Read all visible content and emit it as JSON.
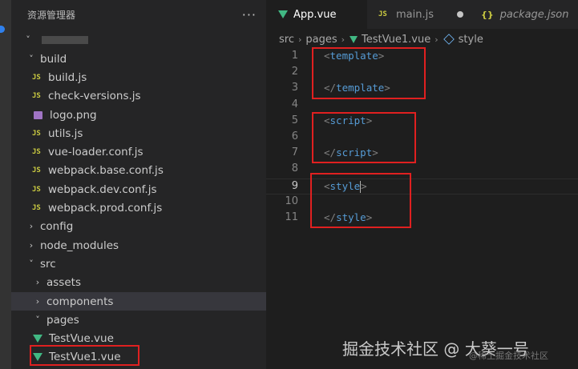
{
  "sidebar": {
    "title": "资源管理器",
    "more": "···",
    "tree": [
      {
        "label": "",
        "kind": "root-redacted",
        "depth": 0,
        "chev": "˅"
      },
      {
        "label": "build",
        "kind": "folder",
        "depth": 1,
        "chev": "˅"
      },
      {
        "label": "build.js",
        "kind": "js",
        "depth": 2
      },
      {
        "label": "check-versions.js",
        "kind": "js",
        "depth": 2
      },
      {
        "label": "logo.png",
        "kind": "img",
        "depth": 2
      },
      {
        "label": "utils.js",
        "kind": "js",
        "depth": 2
      },
      {
        "label": "vue-loader.conf.js",
        "kind": "js",
        "depth": 2
      },
      {
        "label": "webpack.base.conf.js",
        "kind": "js",
        "depth": 2
      },
      {
        "label": "webpack.dev.conf.js",
        "kind": "js",
        "depth": 2
      },
      {
        "label": "webpack.prod.conf.js",
        "kind": "js",
        "depth": 2
      },
      {
        "label": "config",
        "kind": "folder",
        "depth": 1,
        "chev": "›"
      },
      {
        "label": "node_modules",
        "kind": "folder",
        "depth": 1,
        "chev": "›"
      },
      {
        "label": "src",
        "kind": "folder",
        "depth": 1,
        "chev": "˅"
      },
      {
        "label": "assets",
        "kind": "folder",
        "depth": 2,
        "chev": "›"
      },
      {
        "label": "components",
        "kind": "folder",
        "depth": 2,
        "chev": "›",
        "selected": true
      },
      {
        "label": "pages",
        "kind": "folder",
        "depth": 2,
        "chev": "˅"
      },
      {
        "label": "TestVue.vue",
        "kind": "vue",
        "depth": 3
      },
      {
        "label": "TestVue1.vue",
        "kind": "vue",
        "depth": 3
      }
    ]
  },
  "tabs": [
    {
      "label": "App.vue",
      "kind": "vue",
      "active": true
    },
    {
      "label": "main.js",
      "kind": "js",
      "dirty": true
    },
    {
      "label": "package.json",
      "kind": "json",
      "italic": true
    }
  ],
  "icons": {
    "js": "JS",
    "json": "{}",
    "chev_right": "›",
    "chev_down": "˅"
  },
  "breadcrumb": {
    "parts": [
      "src",
      "pages",
      "TestVue1.vue",
      "style"
    ],
    "sep": "›"
  },
  "editor": {
    "current_line": 9,
    "lines": [
      {
        "n": "1",
        "tag": "template",
        "close": false
      },
      {
        "n": "2"
      },
      {
        "n": "3",
        "tag": "template",
        "close": true
      },
      {
        "n": "4"
      },
      {
        "n": "5",
        "tag": "script",
        "close": false
      },
      {
        "n": "6"
      },
      {
        "n": "7",
        "tag": "script",
        "close": true
      },
      {
        "n": "8"
      },
      {
        "n": "9",
        "tag": "style",
        "close": false,
        "cursor": true
      },
      {
        "n": "10"
      },
      {
        "n": "11",
        "tag": "style",
        "close": true
      }
    ]
  },
  "watermark": {
    "main": "掘金技术社区 @ 大葵一号",
    "sub": "@稀土掘金技术社区"
  },
  "colors": {
    "highlight": "#e02020",
    "vue": "#41b883",
    "js": "#cbcb41",
    "tag": "#569cd6"
  }
}
